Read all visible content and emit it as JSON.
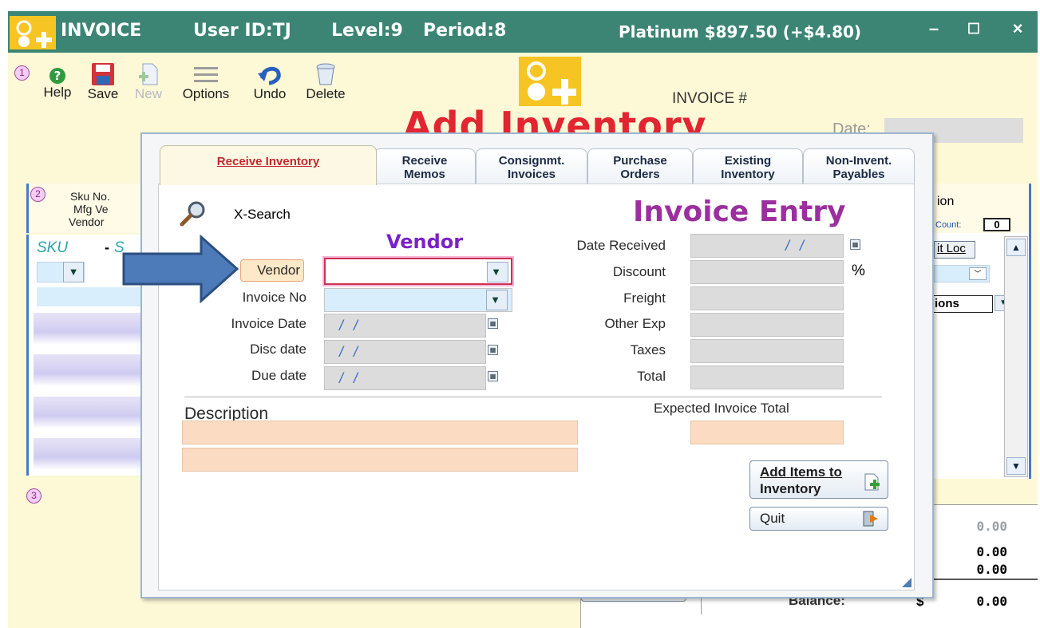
{
  "titlebar": {
    "app": "INVOICE",
    "user": "User ID:TJ",
    "level": "Level:9",
    "period": "Period:8",
    "platinum": "Platinum $897.50 (+$4.80)",
    "minimize": "–",
    "maximize": "☐",
    "close": "×",
    "bg_color": "#3c8575"
  },
  "toolbar": {
    "step1": "1",
    "help": "Help",
    "save": "Save",
    "new": "New",
    "options": "Options",
    "undo": "Undo",
    "delete": "Delete"
  },
  "header": {
    "title": "Add Inventory",
    "invoice_num_label": "INVOICE #",
    "date_label": "Date:"
  },
  "left_panel": {
    "step2": "2",
    "sku_no": "Sku No.",
    "mfg": "Mfg  Ve",
    "vendor": "Vendor",
    "sku": "SKU",
    "sku_dash": "-",
    "sku_s": "S",
    "rows": [
      "-",
      "-",
      "-",
      "-"
    ],
    "step3": "3"
  },
  "right_panel": {
    "ion": "ion",
    "count_label": "Count:",
    "count_value": "0",
    "it_loc": "it Loc",
    "ions": "ions"
  },
  "totals": {
    "v1": "0.00",
    "v2": "0.00",
    "v3": "0.00",
    "balance_label": "Balance:",
    "currency": "$",
    "balance": "0.00"
  },
  "dialog": {
    "tabs": [
      {
        "label": "Receive Inventory",
        "key": "R"
      },
      {
        "line1": "Receive",
        "line2": "Memos"
      },
      {
        "line1": "Consignmt.",
        "line2": "Invoices"
      },
      {
        "line1": "Purchase",
        "line2": "Orders"
      },
      {
        "line1": "Existing",
        "line2": "Inventory"
      },
      {
        "line1": "Non-Invent.",
        "line2": "Payables"
      }
    ],
    "search_label": "X-Search",
    "heading": "Invoice Entry",
    "vendor_heading": "Vendor",
    "vendor_label": "Vendor",
    "invoice_no_label": "Invoice No",
    "invoice_date_label": "Invoice Date",
    "disc_date_label": "Disc date",
    "due_date_label": "Due date",
    "date_placeholder": "/ /",
    "date_received_label": "Date Received",
    "discount_label": "Discount",
    "percent": "%",
    "freight_label": "Freight",
    "other_exp_label": "Other Exp",
    "taxes_label": "Taxes",
    "total_label": "Total",
    "description_label": "Description",
    "expected_total_label": "Expected Invoice Total",
    "add_items_line1": "Add Items to",
    "add_items_line2": "Inventory",
    "quit_label": "Quit"
  }
}
